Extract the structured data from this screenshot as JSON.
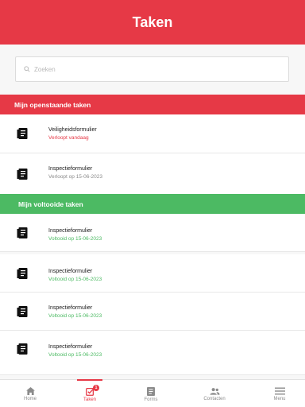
{
  "header": {
    "title": "Taken"
  },
  "search": {
    "placeholder": "Zoeken",
    "value": ""
  },
  "sections": {
    "open": {
      "title": "Mijn openstaande taken",
      "tasks": [
        {
          "name": "Veiligheidsformulier",
          "status": "Verloopt vandaag",
          "status_color": "red"
        },
        {
          "name": "Inspectieformulier",
          "status": "Verloopt op 15-06-2023",
          "status_color": "grey"
        }
      ]
    },
    "done": {
      "title": "Mijn voltooide taken",
      "tasks": [
        {
          "name": "Inspectieformulier",
          "status": "Voltooid op 15-06-2023"
        },
        {
          "name": "Inspectieformulier",
          "status": "Voltooid op 15-06-2023"
        },
        {
          "name": "Inspectieformulier",
          "status": "Voltooid op 15-06-2023"
        },
        {
          "name": "Inspectieformulier",
          "status": "Voltooid op 15-06-2023"
        }
      ]
    }
  },
  "nav": {
    "items": [
      {
        "label": "Home",
        "icon": "home-icon"
      },
      {
        "label": "Taken",
        "icon": "tasks-icon",
        "badge": "1",
        "active": true
      },
      {
        "label": "Forms",
        "icon": "forms-icon"
      },
      {
        "label": "Contacten",
        "icon": "contacts-icon"
      },
      {
        "label": "Menu",
        "icon": "menu-icon"
      }
    ]
  },
  "colors": {
    "brand_red": "#e63946",
    "success_green": "#4cba63",
    "muted_grey": "#8a8a8a"
  }
}
